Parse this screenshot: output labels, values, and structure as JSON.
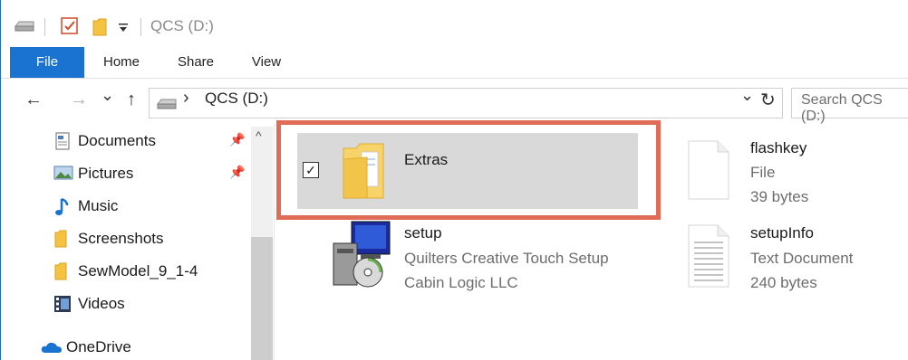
{
  "window": {
    "title": "QCS (D:)"
  },
  "quick_access": {
    "icons": [
      "drive-icon",
      "properties-checkbox-icon",
      "new-folder-icon",
      "customize-dropdown-icon"
    ]
  },
  "ribbon": {
    "tabs": [
      "File",
      "Home",
      "Share",
      "View"
    ]
  },
  "navigation": {
    "back_icon": "←",
    "forward_icon": "→",
    "recent_icon": "⌄",
    "up_icon": "↑",
    "breadcrumb_sep": "›",
    "location": "QCS (D:)",
    "dropdown_icon": "⌄",
    "refresh_icon": "↻",
    "search_placeholder": "Search QCS (D:)"
  },
  "sidebar": {
    "items": [
      {
        "label": "Documents",
        "icon": "documents-icon",
        "pinned": true
      },
      {
        "label": "Pictures",
        "icon": "pictures-icon",
        "pinned": true
      },
      {
        "label": "Music",
        "icon": "music-icon",
        "pinned": false
      },
      {
        "label": "Screenshots",
        "icon": "folder-icon",
        "pinned": false
      },
      {
        "label": "SewModel_9_1-4",
        "icon": "folder-icon",
        "pinned": false
      },
      {
        "label": "Videos",
        "icon": "videos-icon",
        "pinned": false
      },
      {
        "label": "OneDrive",
        "icon": "onedrive-icon",
        "pinned": false
      }
    ],
    "pin_glyph": "📌",
    "scroll_up": "^"
  },
  "files": [
    {
      "name": "Extras",
      "type": "",
      "detail": "",
      "icon": "folder-icon",
      "selected": true,
      "checkbox_glyph": "✓"
    },
    {
      "name": "flashkey",
      "type": "File",
      "detail": "39 bytes",
      "icon": "blank-file-icon",
      "selected": false
    },
    {
      "name": "setup",
      "type": "Quilters Creative Touch Setup",
      "detail": "Cabin Logic LLC",
      "icon": "installer-icon",
      "selected": false
    },
    {
      "name": "setupInfo",
      "type": "Text Document",
      "detail": "240 bytes",
      "icon": "text-document-icon",
      "selected": false
    }
  ],
  "colors": {
    "accent": "#1a73d0",
    "highlight_border": "#e06b57",
    "selection": "#d9d9d9"
  }
}
